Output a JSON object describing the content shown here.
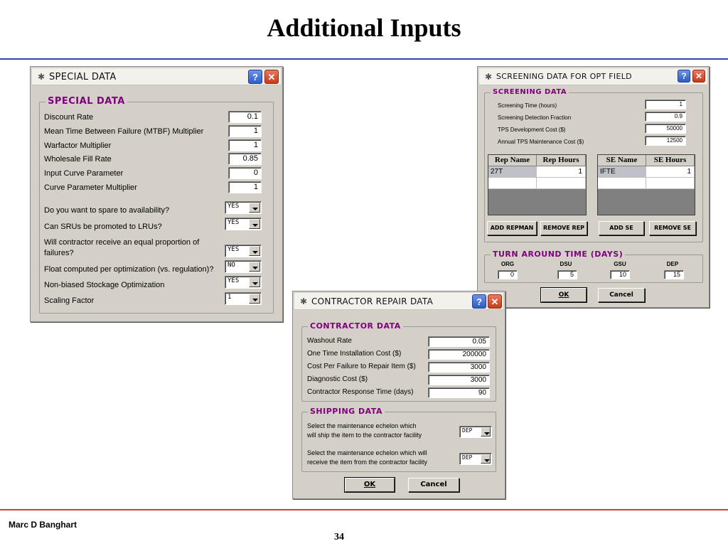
{
  "slide": {
    "title": "Additional Inputs",
    "author": "Marc D Banghart",
    "page": "34"
  },
  "special": {
    "window_title": "SPECIAL DATA",
    "group_title": "SPECIAL DATA",
    "fields": [
      {
        "label": "Discount Rate",
        "value": "0.1"
      },
      {
        "label": "Mean Time Between Failure (MTBF) Multiplier",
        "value": "1"
      },
      {
        "label": "Warfactor Multiplier",
        "value": "1"
      },
      {
        "label": "Wholesale Fill Rate",
        "value": "0.85"
      },
      {
        "label": "Input Curve Parameter",
        "value": "0"
      },
      {
        "label": "Curve Parameter Multiplier",
        "value": "1"
      }
    ],
    "questions": [
      {
        "label": "Do you want to spare to availability?",
        "value": "YES"
      },
      {
        "label": "Can SRUs be promoted to LRUs?",
        "value": "YES"
      },
      {
        "label": "Will contractor receive an equal proportion of",
        "label2": "failures?",
        "value": "YES"
      },
      {
        "label": "Float computed per optimization (vs. regulation)?",
        "value": "NO"
      },
      {
        "label": "Non-biased Stockage Optimization",
        "value": "YES"
      },
      {
        "label": "Scaling Factor",
        "value": "1"
      }
    ]
  },
  "screening": {
    "window_title": "SCREENING DATA FOR OPT FIELD",
    "group_title": "SCREENING DATA",
    "fields": [
      {
        "label": "Screening Time (hours)",
        "value": "1"
      },
      {
        "label": "Screening Detection Fraction",
        "value": "0.9"
      },
      {
        "label": "TPS Development Cost ($)",
        "value": "50000"
      },
      {
        "label": "Annual TPS Maintenance Cost ($)",
        "value": "12500"
      }
    ],
    "rep_table": {
      "headers": [
        "Rep Name",
        "Rep Hours"
      ],
      "rows": [
        [
          "27T",
          "1"
        ]
      ]
    },
    "se_table": {
      "headers": [
        "SE Name",
        "SE Hours"
      ],
      "rows": [
        [
          "IFTE",
          "1"
        ]
      ]
    },
    "buttons": [
      "ADD REPMAN",
      "REMOVE REP",
      "ADD SE",
      "REMOVE SE"
    ],
    "tat_title": "TURN AROUND TIME (DAYS)",
    "tat": [
      {
        "label": "ORG",
        "value": "0"
      },
      {
        "label": "DSU",
        "value": "5"
      },
      {
        "label": "GSU",
        "value": "10"
      },
      {
        "label": "DEP",
        "value": "15"
      }
    ],
    "ok_label": "OK",
    "cancel_label": "Cancel"
  },
  "contractor": {
    "window_title": "CONTRACTOR REPAIR DATA",
    "group_title": "CONTRACTOR DATA",
    "fields": [
      {
        "label": "Washout Rate",
        "value": "0.05"
      },
      {
        "label": "One Time Installation Cost ($)",
        "value": "200000"
      },
      {
        "label": "Cost Per Failure to Repair Item ($)",
        "value": "3000"
      },
      {
        "label": "Diagnostic Cost ($)",
        "value": "3000"
      },
      {
        "label": "Contractor Response Time (days)",
        "value": "90"
      }
    ],
    "shipping_title": "SHIPPING DATA",
    "shipping": [
      {
        "line1": "Select the maintenance echelon which",
        "line2": "will ship the item to the contractor facility",
        "value": "DEP"
      },
      {
        "line1": "Select the maintenance echelon which will",
        "line2": "receive the item from the contractor facility",
        "value": "DEP"
      }
    ],
    "ok_label": "OK",
    "cancel_label": "Cancel"
  }
}
